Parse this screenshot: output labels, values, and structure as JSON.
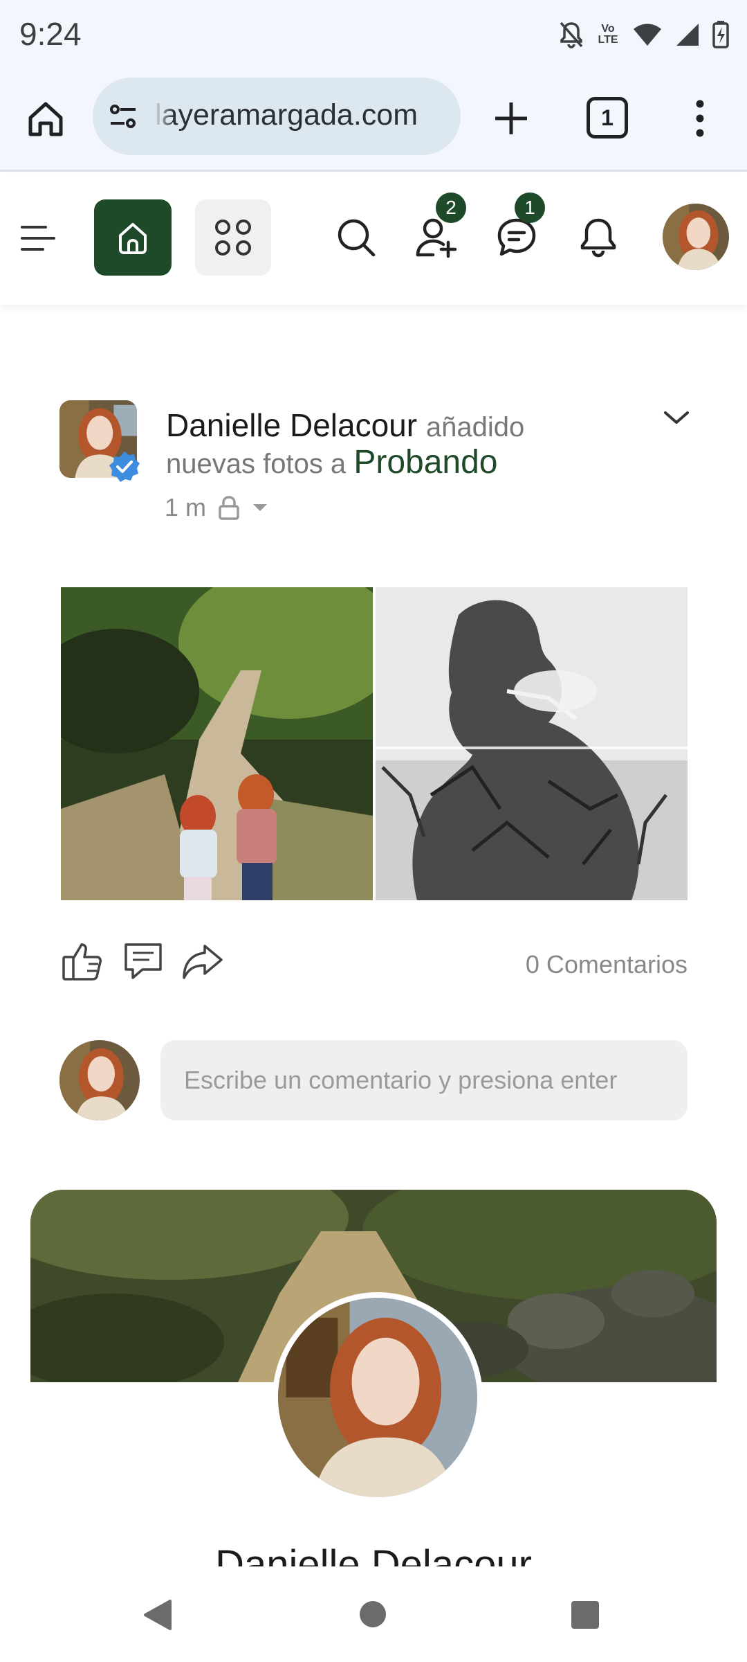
{
  "status_bar": {
    "time": "9:24",
    "volte_line1": "Vo",
    "volte_line2": "LTE"
  },
  "browser": {
    "url": "layeramargada.com",
    "tab_count": "1",
    "icons": [
      "home-icon",
      "site-settings-icon",
      "plus-icon",
      "tabs-icon",
      "more-vert-icon"
    ]
  },
  "header": {
    "friend_requests_badge": "2",
    "messages_badge": "1",
    "accent_color": "#1e4a2a",
    "icons": [
      "menu-icon",
      "home-icon",
      "apps-icon",
      "search-icon",
      "add-user-icon",
      "chat-icon",
      "bell-icon"
    ]
  },
  "post": {
    "author": "Danielle Delacour",
    "action": "añadido",
    "line2_text": "nuevas fotos a",
    "group": "Probando",
    "time": "1 m",
    "comments_count": "0 Comentarios",
    "comment_placeholder": "Escribe un comentario y presiona enter"
  },
  "profile_card": {
    "name": "Danielle Delacour"
  }
}
